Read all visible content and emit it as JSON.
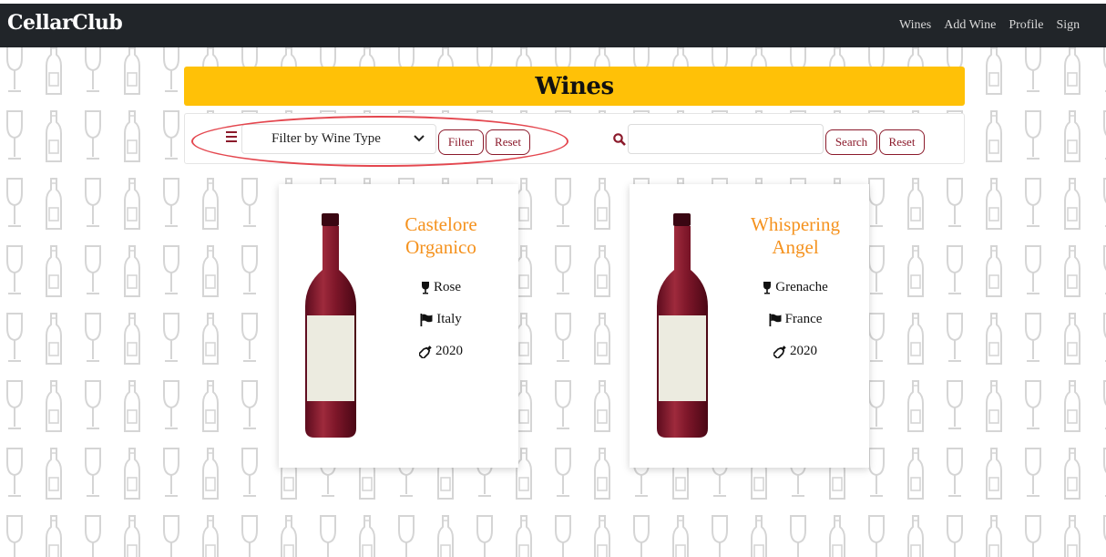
{
  "app": {
    "brand": "CellarClub"
  },
  "nav": {
    "items": [
      "Wines",
      "Add Wine",
      "Profile",
      "Sign"
    ]
  },
  "page": {
    "title": "Wines"
  },
  "filter": {
    "select_value": "Filter by Wine Type",
    "filter_button": "Filter",
    "reset_button": "Reset"
  },
  "search": {
    "value": "",
    "placeholder": "",
    "search_button": "Search",
    "reset_button": "Reset"
  },
  "wines": [
    {
      "name": "Castelore Organico",
      "type": "Rose",
      "country": "Italy",
      "year": "2020"
    },
    {
      "name": "Whispering Angel",
      "type": "Grenache",
      "country": "France",
      "year": "2020"
    }
  ],
  "colors": {
    "navbar": "#212529",
    "title_bar": "#ffc107",
    "accent_maroon": "#8b1a2b",
    "wine_name": "#f5921e",
    "annotation_oval": "#e4474f"
  },
  "icons": [
    "list-icon",
    "chevron-down-icon",
    "search-icon",
    "wine-glass-icon",
    "flag-icon",
    "wine-bottle-tilt-icon"
  ]
}
